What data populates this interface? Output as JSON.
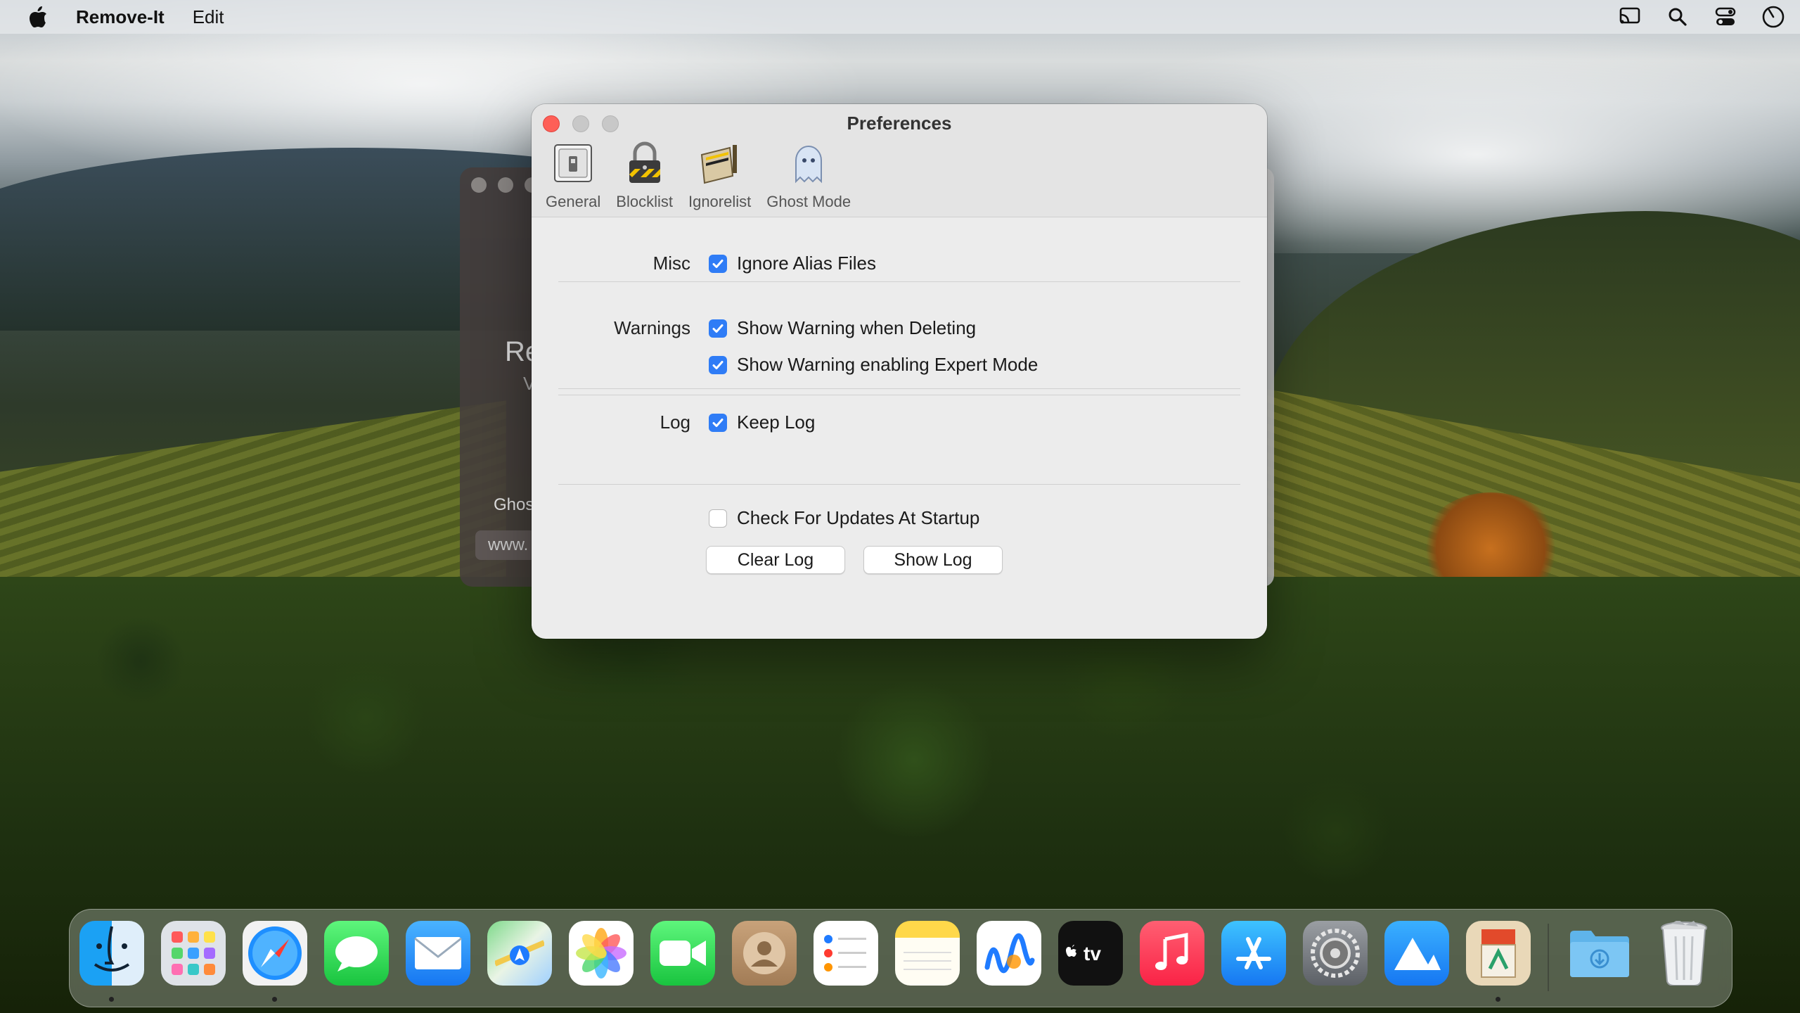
{
  "menubar": {
    "app_name": "Remove-It",
    "menus": [
      "Edit"
    ],
    "status_icons": [
      "cast-icon",
      "spotlight-search-icon",
      "control-center-icon",
      "clock-icon"
    ]
  },
  "background_window": {
    "title_fragment": "Re",
    "subtitle_fragment": "V",
    "ghost_fragment": "Ghos",
    "url_fragment": "www."
  },
  "preferences": {
    "title": "Preferences",
    "toolbar": [
      {
        "label": "General",
        "icon": "switch-icon"
      },
      {
        "label": "Blocklist",
        "icon": "padlock-icon"
      },
      {
        "label": "Ignorelist",
        "icon": "folder-icon"
      },
      {
        "label": "Ghost Mode",
        "icon": "ghost-icon"
      }
    ],
    "sections": {
      "misc": {
        "label": "Misc",
        "ignore_alias": {
          "label": "Ignore Alias Files",
          "checked": true
        }
      },
      "warnings": {
        "label": "Warnings",
        "warn_delete": {
          "label": "Show Warning when Deleting",
          "checked": true
        },
        "warn_expert": {
          "label": "Show Warning enabling Expert Mode",
          "checked": true
        }
      },
      "log": {
        "label": "Log",
        "keep_log": {
          "label": "Keep Log",
          "checked": true
        },
        "clear_button": "Clear Log",
        "show_button": "Show Log"
      },
      "updates": {
        "check_updates": {
          "label": "Check For Updates At Startup",
          "checked": false
        }
      }
    }
  },
  "dock": {
    "apps": [
      "Finder",
      "Launchpad",
      "Safari",
      "Messages",
      "Mail",
      "Maps",
      "Photos",
      "FaceTime",
      "Contacts",
      "Reminders",
      "Notes",
      "Freeform",
      "TV",
      "Music",
      "App Store",
      "System Settings",
      "Remove-It",
      "Archive Utility"
    ],
    "folders": [
      "Downloads",
      "Trash"
    ],
    "colors": {
      "accent": "#2f7cf6",
      "close": "#fe5f57"
    }
  }
}
